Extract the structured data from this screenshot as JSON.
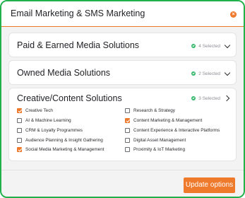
{
  "header": {
    "title": "Email Marketing & SMS Marketing",
    "close_icon": "close-icon"
  },
  "sections": [
    {
      "title": "Paid & Earned Media Solutions",
      "status": "4 Selected",
      "expanded": false
    },
    {
      "title": "Owned Media Solutions",
      "status": "2 Selected",
      "expanded": false
    },
    {
      "title": "Creative/Content Solutions",
      "status": "3 Selected",
      "expanded": true
    }
  ],
  "creative_options": {
    "left": [
      {
        "label": "Creative Tech",
        "checked": true
      },
      {
        "label": "AI & Machine Learning",
        "checked": false
      },
      {
        "label": "CRM & Loyalty Programmes",
        "checked": false
      },
      {
        "label": "Audience Planning & Insight Gathering",
        "checked": false
      },
      {
        "label": "Social Media Marketing & Management",
        "checked": true
      }
    ],
    "right": [
      {
        "label": "Research & Strategy",
        "checked": false
      },
      {
        "label": "Content Marketing & Management",
        "checked": true
      },
      {
        "label": "Content Experience & Interactive Platforms",
        "checked": false
      },
      {
        "label": "Digital Asset Management",
        "checked": false
      },
      {
        "label": "Proximity & IoT Marketing",
        "checked": false
      }
    ]
  },
  "footer": {
    "update_label": "Update options"
  },
  "colors": {
    "accent": "#f07a2c",
    "border": "#22b04b",
    "status_dot": "#33b76a"
  }
}
